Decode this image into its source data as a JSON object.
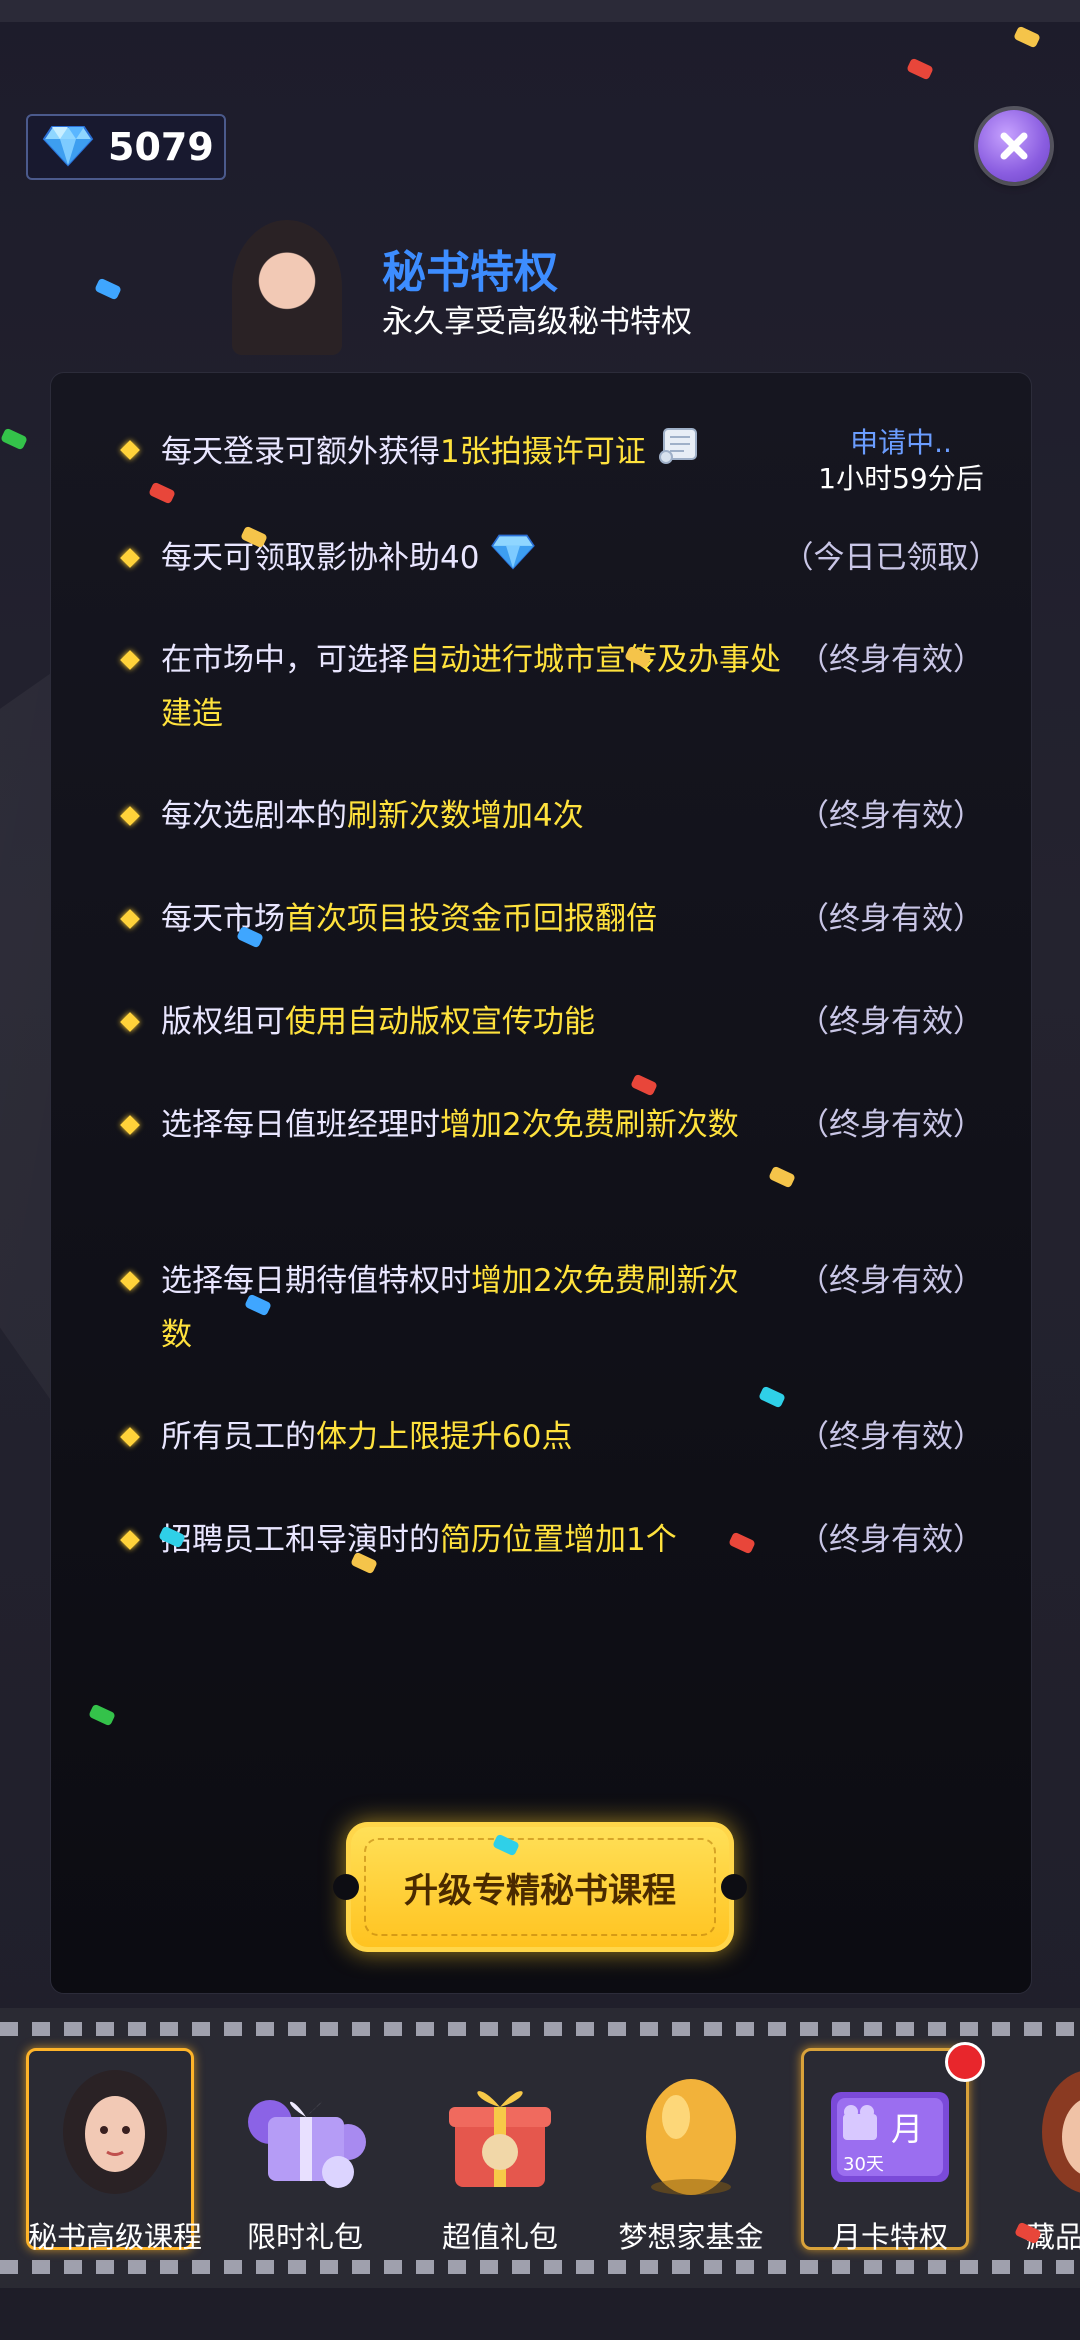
{
  "header": {
    "gem_count": "5079",
    "title": "秘书特权",
    "subtitle": "永久享受高级秘书特权"
  },
  "privileges": [
    {
      "text_plain": "每天登录可额外获得",
      "text_highlight": "1张拍摄许可证",
      "icon": "permit-scroll-icon",
      "status_line1": "申请中..",
      "status_line2": "1小时59分后"
    },
    {
      "text_plain": "每天可领取影协补助40",
      "text_highlight": "",
      "icon": "diamond-icon",
      "status": "（今日已领取）"
    },
    {
      "text_plain": "在市场中，可选择",
      "text_highlight": "自动进行城市宣传及办事处建造",
      "status": "（终身有效）"
    },
    {
      "text_plain": "每次选剧本的",
      "text_highlight": "刷新次数增加4次",
      "status": "（终身有效）"
    },
    {
      "text_plain": "每天市场",
      "text_highlight": "首次项目投资金币回报翻倍",
      "status": "（终身有效）"
    },
    {
      "text_plain": "版权组可",
      "text_highlight": "使用自动版权宣传功能",
      "status": "（终身有效）"
    },
    {
      "text_plain": "选择每日值班经理时",
      "text_highlight": "增加2次免费刷新次数",
      "status": "（终身有效）"
    },
    {
      "text_plain": "选择每日期待值特权时",
      "text_highlight": "增加2次免费刷新次数",
      "status": "（终身有效）"
    },
    {
      "text_plain": "所有员工的",
      "text_highlight": "体力上限提升60点",
      "status": "（终身有效）"
    },
    {
      "text_plain": "招聘员工和导演时的",
      "text_highlight": "简历位置增加1个",
      "status": "（终身有效）"
    }
  ],
  "upgrade_button": {
    "label": "升级专精秘书课程"
  },
  "bottom_tabs": [
    {
      "label": "秘书高级课程",
      "icon": "secretary-avatar-icon",
      "selected": true
    },
    {
      "label": "限时礼包",
      "icon": "purple-gift-icon",
      "selected": false
    },
    {
      "label": "超值礼包",
      "icon": "red-gift-box-icon",
      "selected": false
    },
    {
      "label": "梦想家基金",
      "icon": "golden-egg-icon",
      "selected": false
    },
    {
      "label": "月卡特权",
      "icon": "month-card-icon",
      "card_text": "月",
      "card_sub": "30天",
      "selected": false,
      "has_badge": true
    },
    {
      "label": "藏品",
      "icon": "collection-avatar-icon",
      "selected": false
    }
  ],
  "colors": {
    "accent_blue": "#3d8dff",
    "highlight_yellow": "#ffe23d",
    "status_blue": "#6b9dff"
  }
}
